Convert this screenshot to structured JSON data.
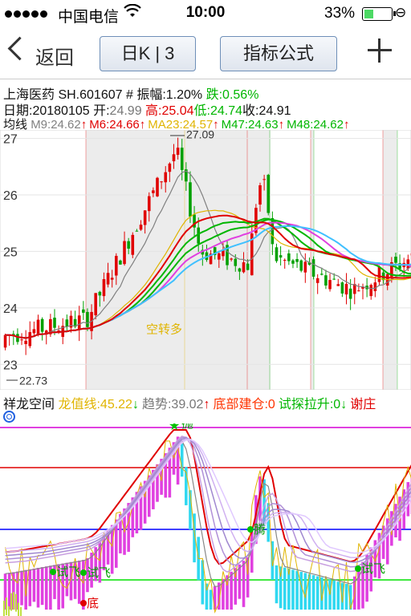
{
  "status_bar": {
    "carrier": "中国电信",
    "time": "10:00",
    "battery": "33%",
    "signal_bars": 5
  },
  "nav": {
    "back_label": "返回",
    "period_button": "日K | 3",
    "indicator_button": "指标公式"
  },
  "stock": {
    "name_code": "上海医药 SH.601607",
    "amp_label": "# 振幅:",
    "amp_value": "1.20%",
    "change_label": "跌:",
    "change_value": "0.56%",
    "date_label": "日期:",
    "date": "20180105",
    "open_label": "开:",
    "open": "24.99",
    "high_label": "高:",
    "high": "25.04",
    "low_label": "低:",
    "low": "24.74",
    "close_label": "收:",
    "close": "24.91"
  },
  "ma_legend": {
    "title": "均线",
    "items": [
      {
        "text": "M9:24.62",
        "arrow": "↑",
        "color": "#808080"
      },
      {
        "text": "M6:24.66",
        "arrow": "↑",
        "color": "#e00000"
      },
      {
        "text": "MA23:24.57",
        "arrow": "↑",
        "color": "#e0b400"
      },
      {
        "text": "M47:24.63",
        "arrow": "↑",
        "color": "#00b600"
      },
      {
        "text": "M48:24.62",
        "arrow": "↑",
        "color": "#00b600"
      }
    ]
  },
  "price_axis": {
    "labels": [
      "27",
      "26",
      "25",
      "24",
      "23"
    ],
    "high_marker": "27.09",
    "low_marker": "22.73",
    "signal_text": "空转多"
  },
  "indicator": {
    "title": "祥龙空间",
    "items": [
      {
        "text": "龙值线:45.22",
        "arrow": "↓",
        "color": "#e0b400",
        "arrow_color": "#00b600"
      },
      {
        "text": "趋势:39.02",
        "arrow": "↑",
        "color": "#777777",
        "arrow_color": "#e00000"
      },
      {
        "text": "底部建仓:0",
        "arrow": "",
        "color": "#ff3300",
        "arrow_color": ""
      },
      {
        "text": "试探拉升:0",
        "arrow": "↓",
        "color": "#00b600",
        "arrow_color": "#00b600"
      },
      {
        "text": "谢庄",
        "arrow": "",
        "color": "#e00000",
        "arrow_color": ""
      }
    ],
    "signals": {
      "pao": "抛",
      "teng": "腾",
      "shi_fei_1": "试飞",
      "shi_fei_2": "试飞",
      "shi_fei_3": "试飞",
      "di": "底"
    }
  },
  "colors": {
    "up": "#e00000",
    "down": "#00a000",
    "ma6": "#e00000",
    "ma9": "#808080",
    "ma23": "#e0b400",
    "ma47": "#00b600",
    "magenta": "#e040e0",
    "blue_line": "#0000ff"
  }
}
